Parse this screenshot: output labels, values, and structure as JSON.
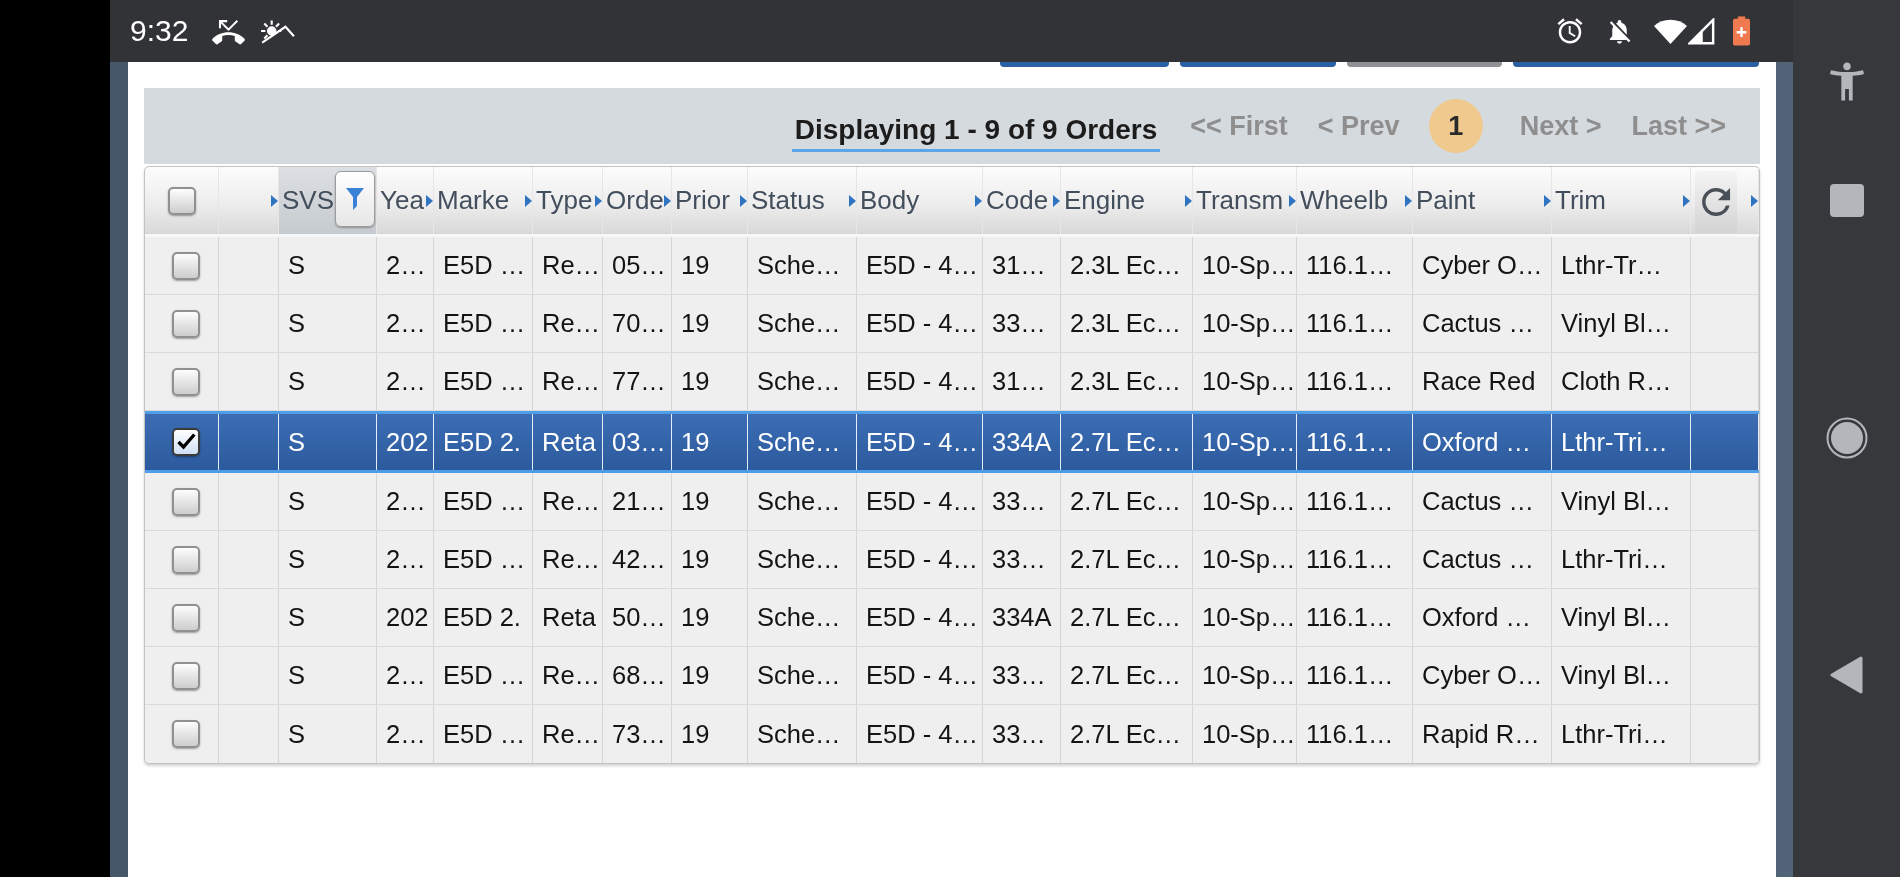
{
  "status_bar": {
    "time": "9:32"
  },
  "toolbar_buttons": [
    {
      "kind": "primary"
    },
    {
      "kind": "primary"
    },
    {
      "kind": "muted"
    },
    {
      "kind": "primary"
    }
  ],
  "pager": {
    "summary": "Displaying 1 - 9 of 9 Orders",
    "controls": [
      {
        "kind": "link",
        "label": "<< First",
        "disabled": true
      },
      {
        "kind": "link",
        "label": "< Prev",
        "disabled": true
      },
      {
        "kind": "page",
        "label": "1",
        "selected": true
      },
      {
        "kind": "link",
        "label": "Next >",
        "disabled": true
      },
      {
        "kind": "link",
        "label": "Last >>",
        "disabled": true
      }
    ]
  },
  "table": {
    "header_checkbox": {
      "checked": false
    },
    "columns": [
      {
        "label": "SVS",
        "filtered": true
      },
      {
        "label": "Yea",
        "filtered": false
      },
      {
        "label": "Marke",
        "filtered": false
      },
      {
        "label": "Type",
        "filtered": false
      },
      {
        "label": "Orde",
        "filtered": false
      },
      {
        "label": "Prior",
        "filtered": false
      },
      {
        "label": "Status",
        "filtered": false
      },
      {
        "label": "Body",
        "filtered": false
      },
      {
        "label": "Code",
        "filtered": false
      },
      {
        "label": "Engine",
        "filtered": false
      },
      {
        "label": "Transm",
        "filtered": false
      },
      {
        "label": "Wheelb",
        "filtered": false
      },
      {
        "label": "Paint",
        "filtered": false
      },
      {
        "label": "Trim",
        "filtered": false
      }
    ],
    "rows": [
      {
        "selected": false,
        "checked": false,
        "cells": [
          "S",
          "2…",
          "E5D …",
          "Re…",
          "05…",
          "19",
          "Sche…",
          "E5D - 4…",
          "31…",
          "2.3L Ec…",
          "10-Sp…",
          "116.1…",
          "Cyber O…",
          "Lthr-Tr…"
        ]
      },
      {
        "selected": false,
        "checked": false,
        "cells": [
          "S",
          "2…",
          "E5D …",
          "Re…",
          "70…",
          "19",
          "Sche…",
          "E5D - 4…",
          "33…",
          "2.3L Ec…",
          "10-Sp…",
          "116.1…",
          "Cactus …",
          "Vinyl Bl…"
        ]
      },
      {
        "selected": false,
        "checked": false,
        "cells": [
          "S",
          "2…",
          "E5D …",
          "Re…",
          "77…",
          "19",
          "Sche…",
          "E5D - 4…",
          "31…",
          "2.3L Ec…",
          "10-Sp…",
          "116.1…",
          "Race Red",
          "Cloth R…"
        ]
      },
      {
        "selected": true,
        "checked": true,
        "cells": [
          "S",
          "202",
          "E5D 2.",
          "Reta",
          "03…",
          "19",
          "Sche…",
          "E5D - 4…",
          "334A",
          "2.7L Ec…",
          "10-Sp…",
          "116.1…",
          "Oxford …",
          "Lthr-Tri…"
        ]
      },
      {
        "selected": false,
        "checked": false,
        "cells": [
          "S",
          "2…",
          "E5D …",
          "Re…",
          "21…",
          "19",
          "Sche…",
          "E5D - 4…",
          "33…",
          "2.7L Ec…",
          "10-Sp…",
          "116.1…",
          "Cactus …",
          "Vinyl Bl…"
        ]
      },
      {
        "selected": false,
        "checked": false,
        "cells": [
          "S",
          "2…",
          "E5D …",
          "Re…",
          "42…",
          "19",
          "Sche…",
          "E5D - 4…",
          "33…",
          "2.7L Ec…",
          "10-Sp…",
          "116.1…",
          "Cactus …",
          "Lthr-Tri…"
        ]
      },
      {
        "selected": false,
        "checked": false,
        "cells": [
          "S",
          "202",
          "E5D 2.",
          "Reta",
          "50…",
          "19",
          "Sche…",
          "E5D - 4…",
          "334A",
          "2.7L Ec…",
          "10-Sp…",
          "116.1…",
          "Oxford …",
          "Vinyl Bl…"
        ]
      },
      {
        "selected": false,
        "checked": false,
        "cells": [
          "S",
          "2…",
          "E5D …",
          "Re…",
          "68…",
          "19",
          "Sche…",
          "E5D - 4…",
          "33…",
          "2.7L Ec…",
          "10-Sp…",
          "116.1…",
          "Cyber O…",
          "Vinyl Bl…"
        ]
      },
      {
        "selected": false,
        "checked": false,
        "cells": [
          "S",
          "2…",
          "E5D …",
          "Re…",
          "73…",
          "19",
          "Sche…",
          "E5D - 4…",
          "33…",
          "2.7L Ec…",
          "10-Sp…",
          "116.1…",
          "Rapid R…",
          "Lthr-Tri…"
        ]
      }
    ]
  }
}
